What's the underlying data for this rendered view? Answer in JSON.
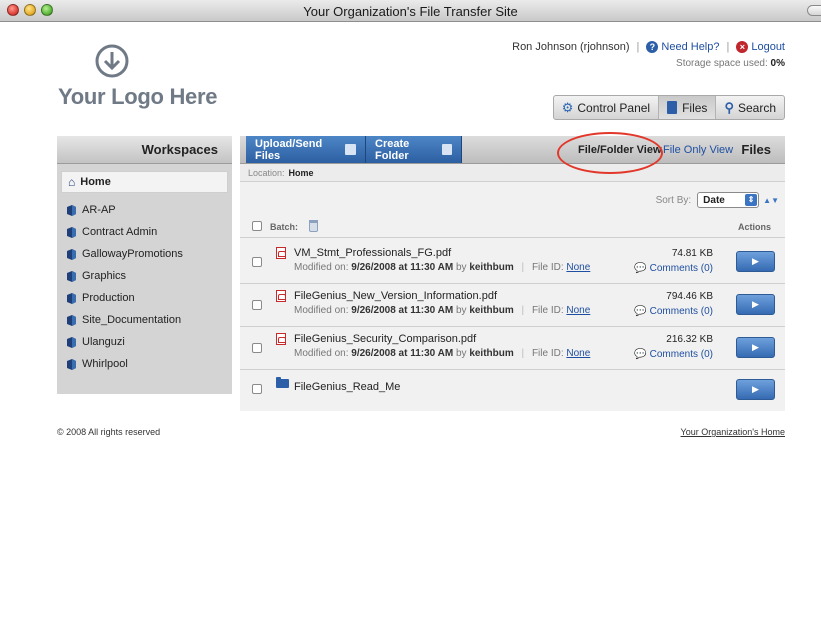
{
  "window": {
    "title": "Your Organization's File Transfer Site"
  },
  "header": {
    "logo_text": "Your Logo Here",
    "user": "Ron Johnson (rjohnson)",
    "help": "Need Help?",
    "logout": "Logout",
    "storage_label": "Storage space used:",
    "storage_value": "0%"
  },
  "topnav": {
    "control_panel": "Control Panel",
    "files": "Files",
    "search": "Search"
  },
  "sidebar": {
    "title": "Workspaces",
    "home": "Home",
    "items": [
      "AR-AP",
      "Contract Admin",
      "GallowayPromotions",
      "Graphics",
      "Production",
      "Site_Documentation",
      "Ulanguzi",
      "Whirlpool"
    ]
  },
  "main": {
    "upload": "Upload/Send Files",
    "create_folder": "Create Folder",
    "view_file_folder": "File/Folder View",
    "view_file_only": "File Only View",
    "title": "Files",
    "location_label": "Location:",
    "location_value": "Home",
    "sort_label": "Sort By:",
    "sort_value": "Date",
    "batch_label": "Batch:",
    "actions_label": "Actions",
    "files": [
      {
        "name": "VM_Stmt_Professionals_FG.pdf",
        "modified_label": "Modified on:",
        "modified": "9/26/2008 at 11:30 AM",
        "by_label": "by",
        "by": "keithbum",
        "file_id_label": "File ID:",
        "file_id": "None",
        "size": "74.81 KB",
        "comments": "Comments (0)"
      },
      {
        "name": "FileGenius_New_Version_Information.pdf",
        "modified_label": "Modified on:",
        "modified": "9/26/2008 at 11:30 AM",
        "by_label": "by",
        "by": "keithbum",
        "file_id_label": "File ID:",
        "file_id": "None",
        "size": "794.46 KB",
        "comments": "Comments (0)"
      },
      {
        "name": "FileGenius_Security_Comparison.pdf",
        "modified_label": "Modified on:",
        "modified": "9/26/2008 at 11:30 AM",
        "by_label": "by",
        "by": "keithbum",
        "file_id_label": "File ID:",
        "file_id": "None",
        "size": "216.32 KB",
        "comments": "Comments (0)"
      }
    ],
    "folder": {
      "name": "FileGenius_Read_Me"
    }
  },
  "footer": {
    "copyright": "© 2008 All rights reserved",
    "home_link": "Your Organization's Home"
  },
  "colors": {
    "accent": "#2c5fa8",
    "highlight_circle": "#e2382b",
    "logo_gray": "#6f7a86"
  },
  "icons": {
    "logo": "down-arrow-circle-icon",
    "help": "question-icon",
    "logout": "x-icon",
    "control_panel": "gear-icon",
    "files": "file-icon",
    "search": "magnifier-icon",
    "workspace": "shield-icon",
    "home": "house-icon",
    "file": "pdf-icon",
    "folder": "folder-icon",
    "action": "play-arrow-icon"
  }
}
